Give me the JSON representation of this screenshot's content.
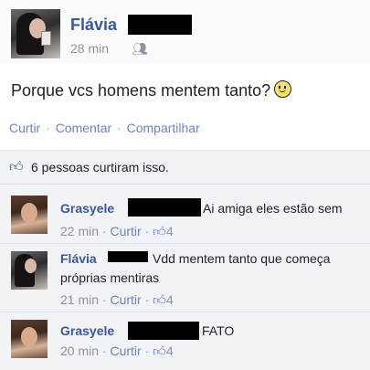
{
  "post": {
    "author": "Flávia",
    "time": "28 min",
    "privacy_icon": "friends-icon",
    "text": "Porque vcs homens mentem tanto?",
    "emoji": "smiley-icon",
    "actions": [
      "Curtir",
      "Comentar",
      "Compartilhar"
    ],
    "action_sep": "·",
    "likes_text": "6 pessoas curtiram isso."
  },
  "comments": [
    {
      "author": "Grasyele",
      "text": "Ai amiga eles estão sem",
      "time": "22 min",
      "like_label": "Curtir",
      "likes": "4"
    },
    {
      "author": "Flávia",
      "text": "Vdd mentem tanto que começa",
      "text_line2": "próprias mentiras",
      "time": "21 min",
      "like_label": "Curtir",
      "likes": "4"
    },
    {
      "author": "Grasyele",
      "text": "FATO",
      "time": "20 min",
      "like_label": "Curtir",
      "likes": "4"
    }
  ],
  "colors": {
    "link_blue": "#3b5998",
    "action_blue": "#6d84b4",
    "meta_gray": "#90949c",
    "comment_bg": "#f2f3f7"
  }
}
